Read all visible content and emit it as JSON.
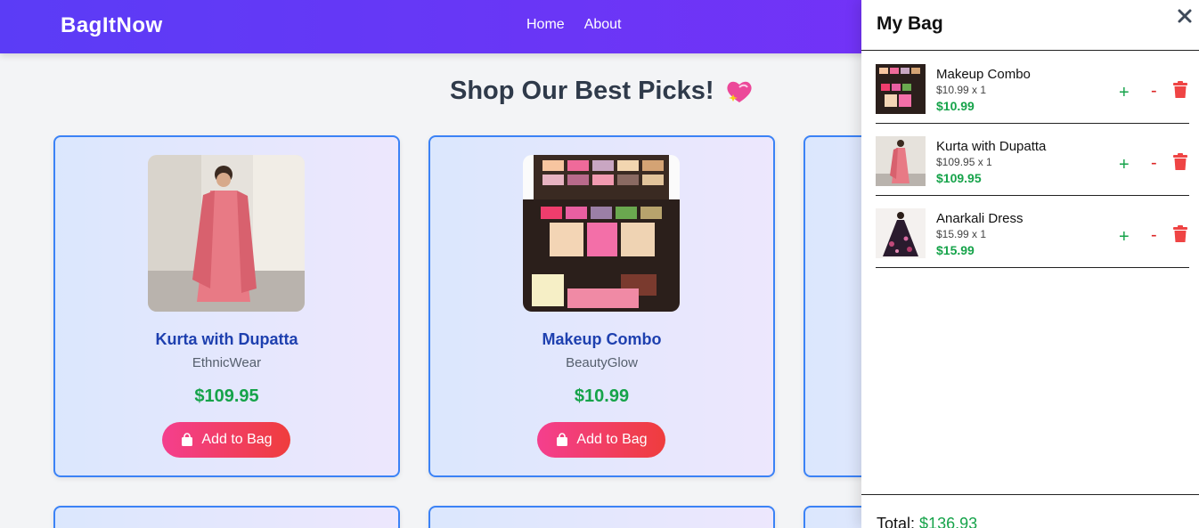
{
  "navbar": {
    "brand": "BagItNow",
    "links": [
      "Home",
      "About"
    ]
  },
  "main": {
    "heading": "Shop Our Best Picks!",
    "heading_icon": "sparkling-heart-icon",
    "products": [
      {
        "title": "Kurta with Dupatta",
        "brand": "EthnicWear",
        "price": "$109.95",
        "button": "Add to Bag"
      },
      {
        "title": "Makeup Combo",
        "brand": "BeautyGlow",
        "price": "$10.99",
        "button": "Add to Bag"
      }
    ]
  },
  "cart": {
    "title": "My Bag",
    "items": [
      {
        "name": "Makeup Combo",
        "qty_line": "$10.99 x 1",
        "total": "$10.99",
        "plus": "+",
        "minus": "-"
      },
      {
        "name": "Kurta with Dupatta",
        "qty_line": "$109.95 x 1",
        "total": "$109.95",
        "plus": "+",
        "minus": "-"
      },
      {
        "name": "Anarkali Dress",
        "qty_line": "$15.99 x 1",
        "total": "$15.99",
        "plus": "+",
        "minus": "-"
      }
    ],
    "total_label": "Total:",
    "total_value": "$136.93"
  },
  "colors": {
    "accent": "#5b3cf6",
    "price_green": "#16a34a",
    "card_border": "#3b82f6",
    "button_pink": "#f43f8e",
    "delete_red": "#ef4444"
  }
}
